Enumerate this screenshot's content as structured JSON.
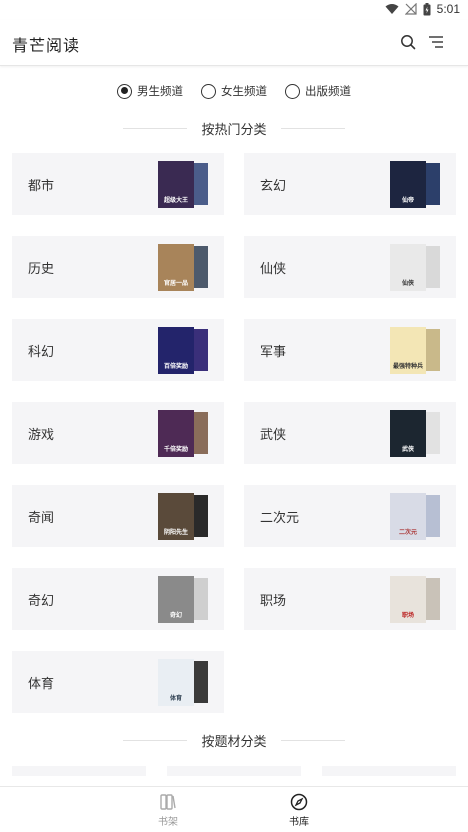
{
  "status": {
    "time": "5:01",
    "icons": [
      "wifi-icon",
      "signal-off-icon",
      "battery-icon"
    ]
  },
  "appbar": {
    "title": "青芒阅读",
    "search_icon": "search-icon",
    "menu_icon": "sort-menu-icon"
  },
  "channels": [
    {
      "label": "男生频道",
      "selected": true
    },
    {
      "label": "女生频道",
      "selected": false
    },
    {
      "label": "出版频道",
      "selected": false
    }
  ],
  "sections": {
    "hot": "按热门分类",
    "theme": "按题材分类"
  },
  "categories": [
    {
      "label": "都市",
      "cover_text": "超级大王",
      "cover_color": "#3a2a52",
      "back_color": "#4b5d8a"
    },
    {
      "label": "玄幻",
      "cover_text": "仙帝",
      "cover_color": "#1d2540",
      "back_color": "#2c3f6a"
    },
    {
      "label": "历史",
      "cover_text": "官居一品",
      "cover_color": "#a8845a",
      "back_color": "#4d5a6c"
    },
    {
      "label": "仙侠",
      "cover_text": "仙侠",
      "cover_color": "#e9e9e9",
      "back_color": "#d9d9d9"
    },
    {
      "label": "科幻",
      "cover_text": "百倍奖励",
      "cover_color": "#23246b",
      "back_color": "#3a2f7a"
    },
    {
      "label": "军事",
      "cover_text": "最强特种兵",
      "cover_color": "#f3e6b5",
      "back_color": "#c9b98a"
    },
    {
      "label": "游戏",
      "cover_text": "千倍奖励",
      "cover_color": "#4e2a55",
      "back_color": "#8a6d5a"
    },
    {
      "label": "武侠",
      "cover_text": "武侠",
      "cover_color": "#1c2630",
      "back_color": "#e2e2e2"
    },
    {
      "label": "奇闻",
      "cover_text": "阴阳先生",
      "cover_color": "#5a4a3a",
      "back_color": "#2a2a2a"
    },
    {
      "label": "二次元",
      "cover_text": "二次元",
      "cover_color": "#d8dbe6",
      "back_color": "#b7bfd3"
    },
    {
      "label": "奇幻",
      "cover_text": "奇幻",
      "cover_color": "#8a8a8a",
      "back_color": "#cfcfcf"
    },
    {
      "label": "职场",
      "cover_text": "职场",
      "cover_color": "#e8e3dc",
      "back_color": "#c9c2b8"
    },
    {
      "label": "体育",
      "cover_text": "体育",
      "cover_color": "#e9eef3",
      "back_color": "#3a3a3a"
    }
  ],
  "bottom_nav": [
    {
      "label": "书架",
      "icon": "bookshelf-icon",
      "active": false
    },
    {
      "label": "书库",
      "icon": "compass-icon",
      "active": true
    }
  ]
}
